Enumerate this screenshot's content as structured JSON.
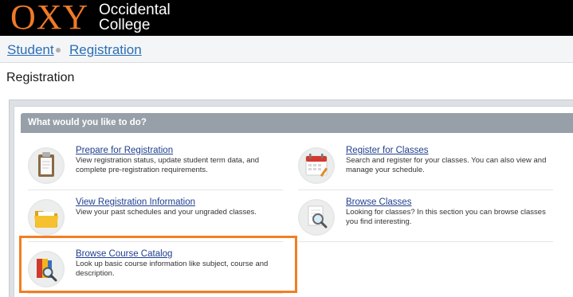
{
  "header": {
    "logo_mark": "OXY",
    "logo_line1": "Occidental",
    "logo_line2": "College"
  },
  "breadcrumb": {
    "items": [
      "Student",
      "Registration"
    ]
  },
  "page": {
    "title": "Registration"
  },
  "panel": {
    "heading": "What would you like to do?",
    "tasks": [
      {
        "icon": "clipboard-icon",
        "title": "Prepare for Registration",
        "description": "View registration status, update student term data, and complete pre-registration requirements."
      },
      {
        "icon": "calendar-icon",
        "title": "Register for Classes",
        "description": "Search and register for your classes. You can also view and manage your schedule."
      },
      {
        "icon": "folder-icon",
        "title": "View Registration Information",
        "description": "View your past schedules and your ungraded classes."
      },
      {
        "icon": "magnifier-document-icon",
        "title": "Browse Classes",
        "description": "Looking for classes? In this section you can browse classes you find interesting."
      },
      {
        "icon": "books-magnifier-icon",
        "title": "Browse Course Catalog",
        "description": "Look up basic course information like subject, course and description."
      }
    ]
  },
  "colors": {
    "brand_orange": "#f07a28",
    "link_blue": "#2a6fb5",
    "header_gray": "#97a0a8",
    "highlight_orange": "#f37e22"
  }
}
